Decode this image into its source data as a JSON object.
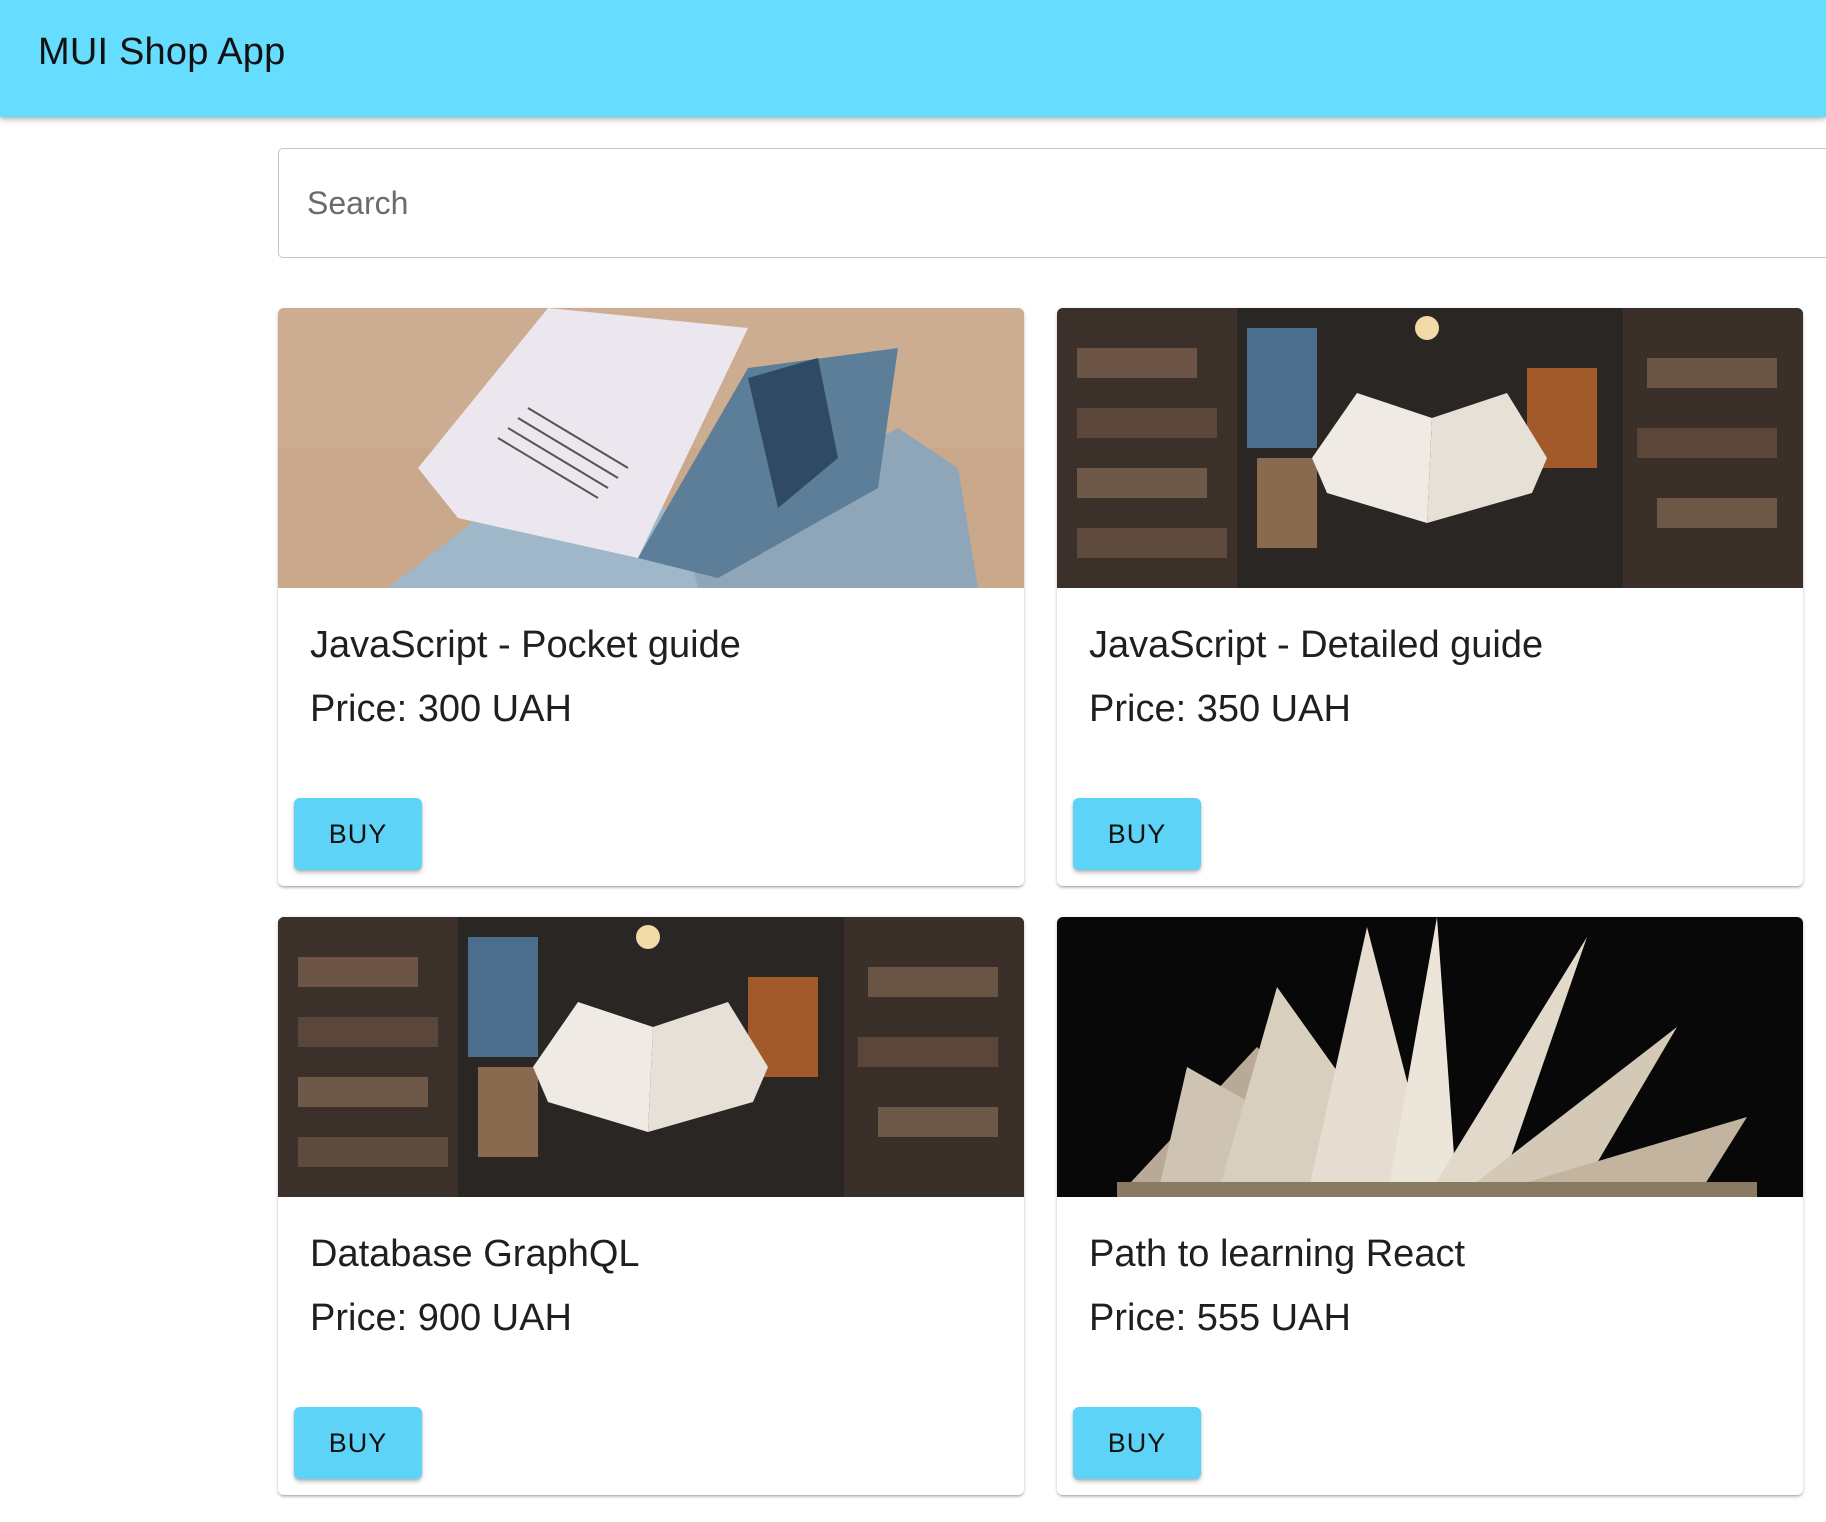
{
  "appbar": {
    "title": "MUI Shop App",
    "color": "#66dcff"
  },
  "search": {
    "placeholder": "Search",
    "value": ""
  },
  "products": [
    {
      "title": "JavaScript - Pocket guide",
      "price": "Price: 300 UAH",
      "button": "BUY",
      "image": "open-book-photo"
    },
    {
      "title": "JavaScript - Detailed guide",
      "price": "Price: 350 UAH",
      "button": "BUY",
      "image": "library-floating-book-photo"
    },
    {
      "title": "Database GraphQL",
      "price": "Price: 900 UAH",
      "button": "BUY",
      "image": "library-floating-book-photo"
    },
    {
      "title": "Path to learning React",
      "price": "Price: 555 UAH",
      "button": "BUY",
      "image": "fanned-book-photo"
    }
  ],
  "colors": {
    "button": "#5dd3f7"
  }
}
